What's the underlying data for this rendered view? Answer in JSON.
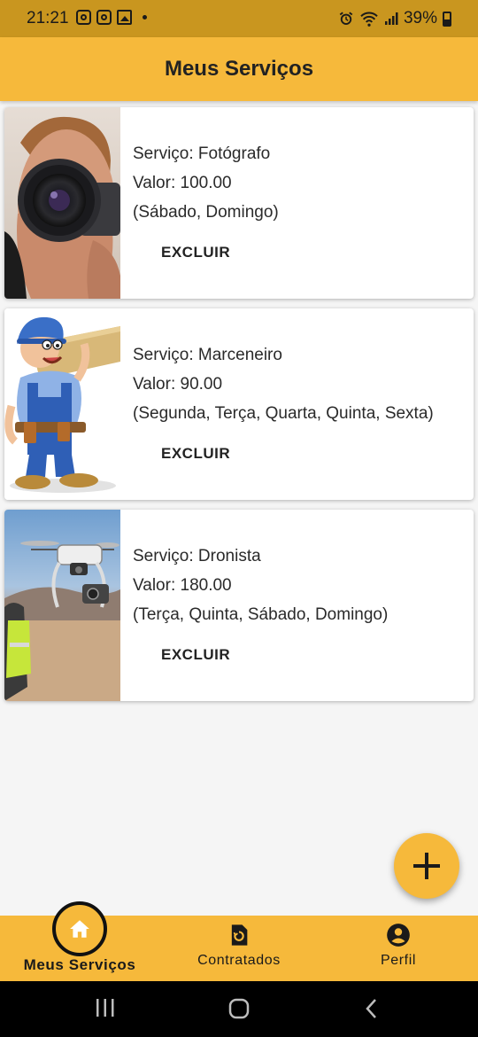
{
  "status_bar": {
    "time": "21:21",
    "battery": "39%"
  },
  "app_bar": {
    "title": "Meus Serviços"
  },
  "services": [
    {
      "service": "Serviço: Fotógrafo",
      "value": "Valor: 100.00",
      "days": "(Sábado, Domingo)",
      "delete_label": "EXCLUIR",
      "image": "photographer-photo"
    },
    {
      "service": "Serviço: Marceneiro",
      "value": "Valor: 90.00",
      "days": "(Segunda, Terça, Quarta, Quinta, Sexta)",
      "delete_label": "EXCLUIR",
      "image": "carpenter-cartoon"
    },
    {
      "service": "Serviço: Dronista",
      "value": "Valor: 180.00",
      "days": "(Terça, Quinta, Sábado, Domingo)",
      "delete_label": "EXCLUIR",
      "image": "drone-photo"
    }
  ],
  "fab": {
    "icon": "plus-icon"
  },
  "bottom_nav": {
    "items": [
      {
        "label": "Meus Serviços",
        "icon": "home-icon",
        "active": true
      },
      {
        "label": "Contratados",
        "icon": "contract-icon",
        "active": false
      },
      {
        "label": "Perfil",
        "icon": "account-icon",
        "active": false
      }
    ]
  },
  "colors": {
    "primary": "#f6b93b",
    "status_bar": "#c9961f",
    "background": "#f5f5f5",
    "text": "#222222"
  }
}
